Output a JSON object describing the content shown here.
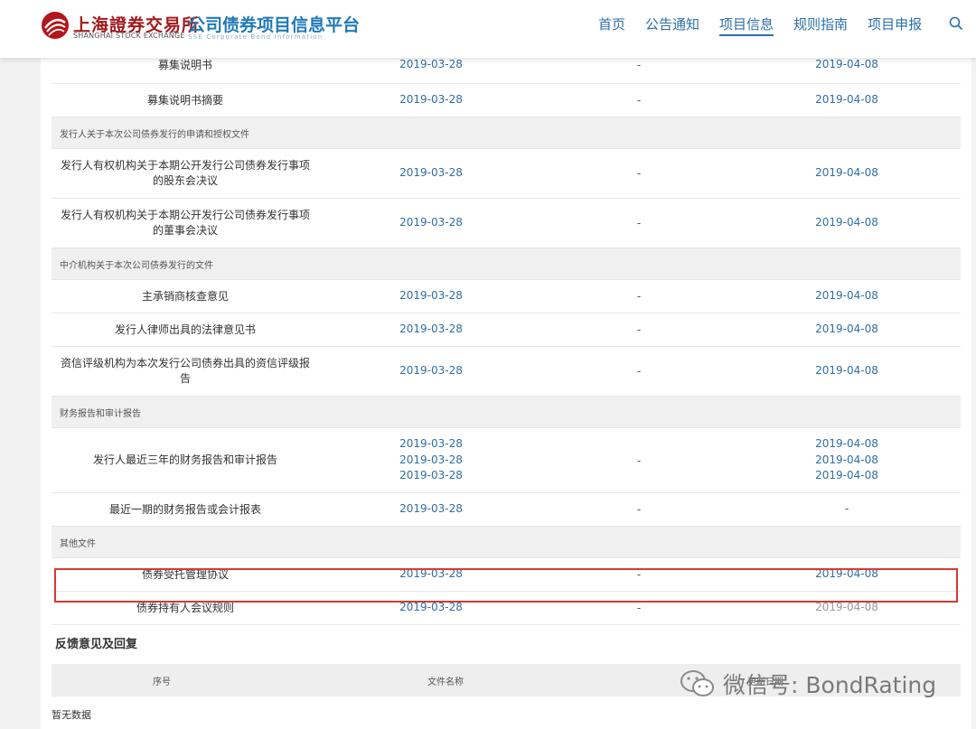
{
  "header": {
    "logo_cn": "上海證券交易所",
    "logo_en": "SHANGHAI STOCK EXCHANGE",
    "platform_cn": "公司债券项目信息平台",
    "platform_en": "SSE Corporate Bond Information",
    "nav": [
      "首页",
      "公告通知",
      "项目信息",
      "规则指南",
      "项目申报"
    ],
    "active_nav": "项目信息",
    "search_icon": "search-icon"
  },
  "rows": [
    {
      "type": "doc",
      "name": "募集说明书",
      "date1": [
        "2019-03-28"
      ],
      "mid": "-",
      "date2": [
        "2019-04-08"
      ]
    },
    {
      "type": "doc",
      "name": "募集说明书摘要",
      "date1": [
        "2019-03-28"
      ],
      "mid": "-",
      "date2": [
        "2019-04-08"
      ]
    },
    {
      "type": "cat",
      "title": "发行人关于本次公司债券发行的申请和授权文件"
    },
    {
      "type": "doc",
      "name": "发行人有权机构关于本期公开发行公司债券发行事项的股东会决议",
      "date1": [
        "2019-03-28"
      ],
      "mid": "-",
      "date2": [
        "2019-04-08"
      ]
    },
    {
      "type": "doc",
      "name": "发行人有权机构关于本期公开发行公司债券发行事项的董事会决议",
      "date1": [
        "2019-03-28"
      ],
      "mid": "-",
      "date2": [
        "2019-04-08"
      ]
    },
    {
      "type": "cat",
      "title": "中介机构关于本次公司债券发行的文件"
    },
    {
      "type": "doc",
      "name": "主承销商核查意见",
      "date1": [
        "2019-03-28"
      ],
      "mid": "-",
      "date2": [
        "2019-04-08"
      ]
    },
    {
      "type": "doc",
      "name": "发行人律师出具的法律意见书",
      "date1": [
        "2019-03-28"
      ],
      "mid": "-",
      "date2": [
        "2019-04-08"
      ]
    },
    {
      "type": "doc",
      "name": "资信评级机构为本次发行公司债券出具的资信评级报告",
      "date1": [
        "2019-03-28"
      ],
      "mid": "-",
      "date2": [
        "2019-04-08"
      ]
    },
    {
      "type": "cat",
      "title": "财务报告和审计报告"
    },
    {
      "type": "doc",
      "name": "发行人最近三年的财务报告和审计报告",
      "date1": [
        "2019-03-28",
        "2019-03-28",
        "2019-03-28"
      ],
      "mid": "-",
      "date2": [
        "2019-04-08",
        "2019-04-08",
        "2019-04-08"
      ]
    },
    {
      "type": "doc",
      "name": "最近一期的财务报告或会计报表",
      "date1": [
        "2019-03-28"
      ],
      "mid": "-",
      "date2": [
        "-"
      ]
    },
    {
      "type": "cat",
      "title": "其他文件"
    },
    {
      "type": "doc",
      "name": "债券受托管理协议",
      "date1": [
        "2019-03-28"
      ],
      "mid": "-",
      "date2": [
        "2019-04-08"
      ]
    },
    {
      "type": "doc",
      "name": "债券持有人会议规则",
      "date1": [
        "2019-03-28"
      ],
      "mid": "-",
      "date2": [
        "2019-04-08"
      ],
      "highlighted": true
    }
  ],
  "feedback": {
    "title": "反馈意见及回复",
    "columns": [
      "序号",
      "文件名称",
      "更新日期"
    ],
    "empty_text": "暂无数据"
  },
  "watermark": {
    "text": "微信号: BondRating",
    "icon": "wechat-icon"
  },
  "colors": {
    "link_blue": "#2f6fa6",
    "nav_blue": "#2d6fa8",
    "highlight_red": "#d9392f",
    "brand_red": "#a11a1d"
  }
}
